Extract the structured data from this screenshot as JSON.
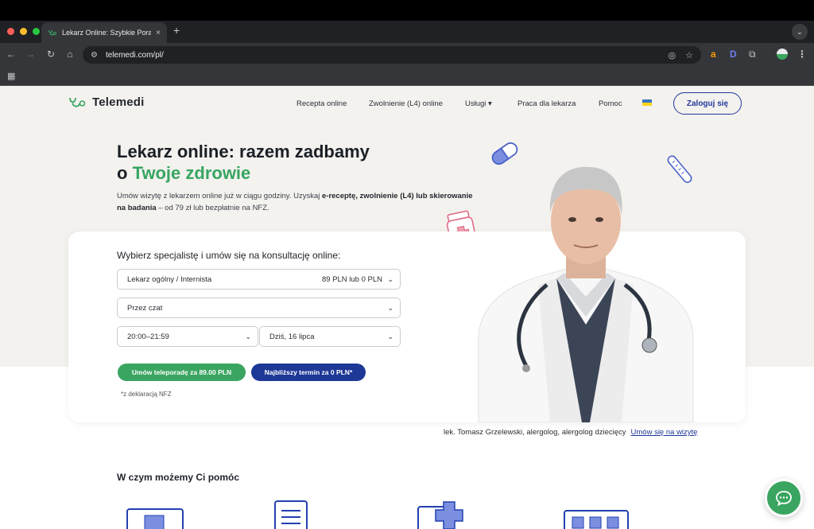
{
  "browser": {
    "tab_title": "Lekarz Online: Szybkie Porad",
    "tab_close": "×",
    "new_tab": "+",
    "url": "telemedi.com/pl/",
    "extensions": [
      "a",
      "D"
    ]
  },
  "header": {
    "logo": "Telemedi",
    "nav": [
      "Recepta online",
      "Zwolnienie (L4) online",
      "Usługi ▾",
      "Praca dla lekarza",
      "Pomoc"
    ],
    "login_label": "Zaloguj się"
  },
  "hero": {
    "title_line1": "Lekarz online: razem zadbamy",
    "title_o": "o ",
    "title_green": "Twoje zdrowie",
    "desc_1": "Umów wizytę z lekarzem online już w ciągu godziny. Uzyskaj ",
    "desc_bold": "e-receptę, zwolnienie (L4) lub skierowanie na badania",
    "desc_2": " – od 79 zł lub bezpłatnie na NFZ."
  },
  "booking": {
    "title": "Wybierz specjalistę i umów się na konsultację online:",
    "specialist": "Lekarz ogólny / Internista",
    "price": "89 PLN lub 0 PLN",
    "channel": "Przez czat",
    "time": "20:00–21:59",
    "date": "Dziś, 16 lipca",
    "btn_paid": "Umów teleporadę za  89.00 PLN",
    "btn_nfz": "Najbliższy termin za 0 PLN*",
    "note": "*z deklaracją NFZ"
  },
  "doctor_caption": {
    "text": "lek. Tomasz Grzelewski, alergolog, alergolog dziecięcy",
    "link": "Umów się na wizytę"
  },
  "section_help": {
    "title": "W czym możemy Ci pomóc"
  },
  "colors": {
    "green": "#37a562",
    "navy": "#1e3897",
    "hero_bg": "#f4f2ee"
  }
}
